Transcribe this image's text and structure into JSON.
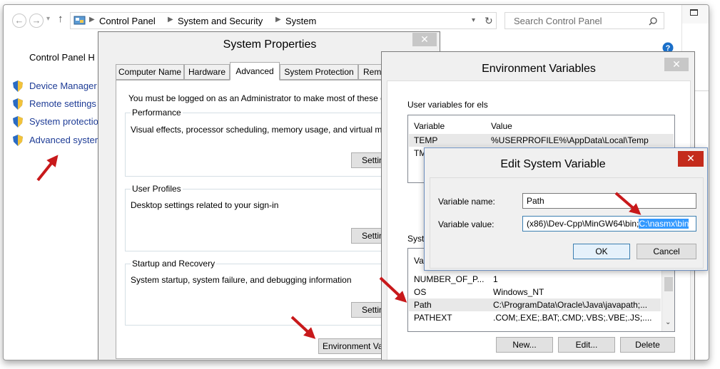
{
  "explorer": {
    "back_glyph": "←",
    "fwd_glyph": "→",
    "up_glyph": "↑",
    "breadcrumb": [
      "Control Panel",
      "System and Security",
      "System"
    ],
    "search_placeholder": "Search Control Panel",
    "cp_home": "Control Panel H",
    "left_links": [
      "Device Manager",
      "Remote settings",
      "System protectio",
      "Advanced syster"
    ]
  },
  "system_properties": {
    "title": "System Properties",
    "tabs": [
      "Computer Name",
      "Hardware",
      "Advanced",
      "System Protection",
      "Remo"
    ],
    "active_tab": "Advanced",
    "admin_note": "You must be logged on as an Administrator to make most of these c",
    "performance": {
      "label": "Performance",
      "desc": "Visual effects, processor scheduling, memory usage, and virtual me",
      "button": "Setting"
    },
    "user_profiles": {
      "label": "User Profiles",
      "desc": "Desktop settings related to your sign-in",
      "button": "Setting"
    },
    "startup": {
      "label": "Startup and Recovery",
      "desc": "System startup, system failure, and debugging information",
      "button": "Setting"
    },
    "env_button": "Environment Vari"
  },
  "env_vars": {
    "title": "Environment Variables",
    "user_label": "User variables for els",
    "user_headers": [
      "Variable",
      "Value"
    ],
    "user_rows": [
      {
        "name": "TEMP",
        "value": "%USERPROFILE%\\AppData\\Local\\Temp"
      },
      {
        "name": "TM",
        "value": ""
      }
    ],
    "sys_label": "Syste",
    "sys_header_partial": "Var",
    "sys_rows": [
      {
        "name": "NUMBER_OF_P...",
        "value": "1"
      },
      {
        "name": "OS",
        "value": "Windows_NT"
      },
      {
        "name": "Path",
        "value": "C:\\ProgramData\\Oracle\\Java\\javapath;..."
      },
      {
        "name": "PATHEXT",
        "value": ".COM;.EXE;.BAT;.CMD;.VBS;.VBE;.JS;...."
      }
    ],
    "buttons": {
      "new": "New...",
      "edit": "Edit...",
      "delete": "Delete"
    }
  },
  "edit_var": {
    "title": "Edit System Variable",
    "name_label": "Variable name:",
    "name_value": "Path",
    "value_label": "Variable value:",
    "value_plain": "(x86)\\Dev-Cpp\\MinGW64\\bin;",
    "value_selected": "C:\\nasmx\\bin",
    "ok": "OK",
    "cancel": "Cancel"
  },
  "colors": {
    "accent_red": "#c8191b",
    "link_blue": "#1e3c96",
    "selection": "#3399ff"
  }
}
